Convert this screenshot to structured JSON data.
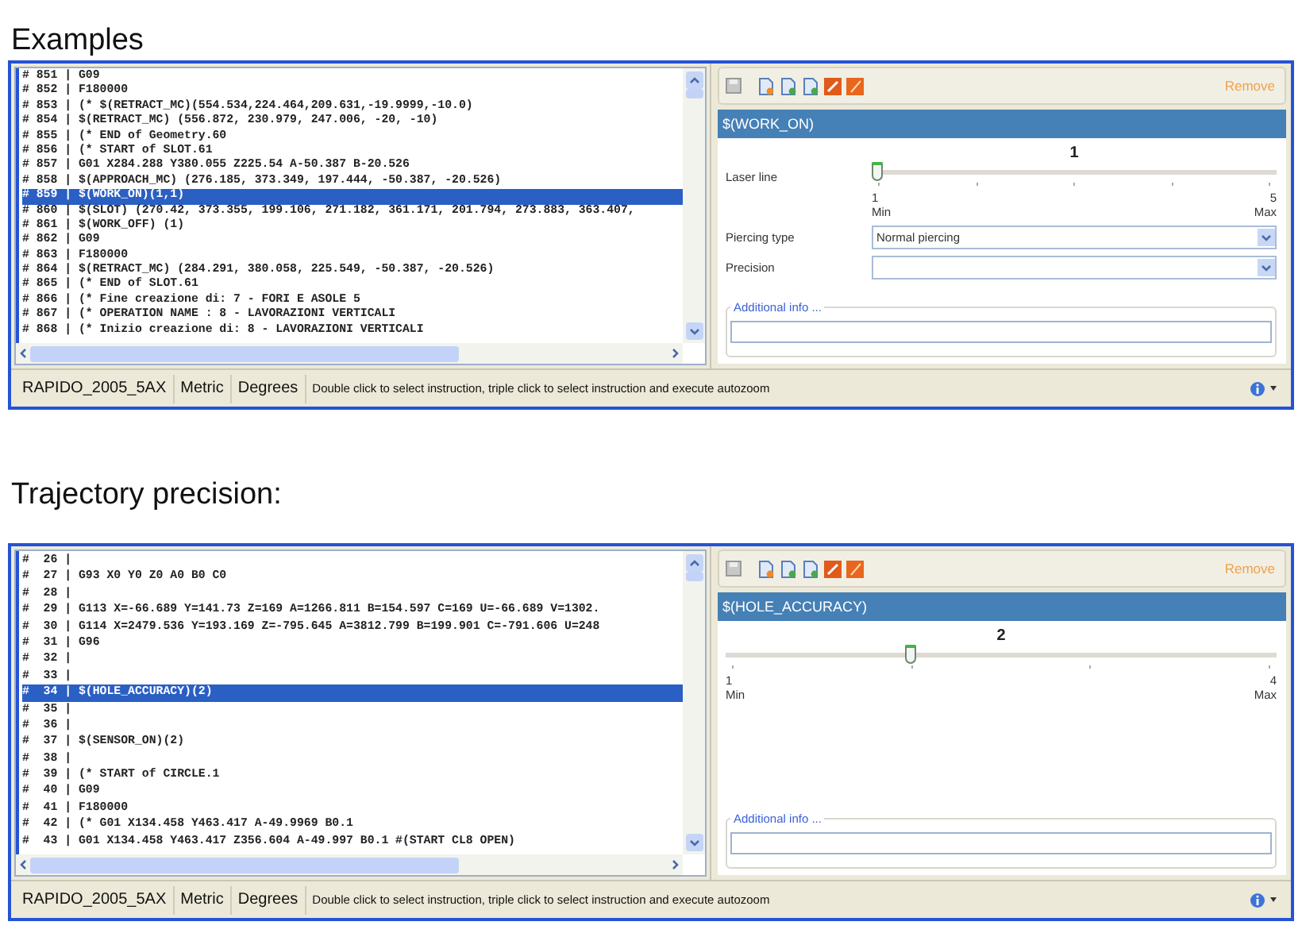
{
  "sections": [
    {
      "heading": "Examples",
      "window": {
        "code_lines": [
          {
            "text": "# 851 | G09",
            "selected": false
          },
          {
            "text": "# 852 | F180000",
            "selected": false
          },
          {
            "text": "# 853 | (* $(RETRACT_MC)(554.534,224.464,209.631,-19.9999,-10.0)",
            "selected": false
          },
          {
            "text": "# 854 | $(RETRACT_MC) (556.872, 230.979, 247.006, -20, -10)",
            "selected": false
          },
          {
            "text": "# 855 | (* END of Geometry.60",
            "selected": false
          },
          {
            "text": "# 856 | (* START of SLOT.61",
            "selected": false
          },
          {
            "text": "# 857 | G01 X284.288 Y380.055 Z225.54 A-50.387 B-20.526",
            "selected": false
          },
          {
            "text": "# 858 | $(APPROACH_MC) (276.185, 373.349, 197.444, -50.387, -20.526)",
            "selected": false
          },
          {
            "text": "# 859 | $(WORK_ON)(1,1)",
            "selected": true
          },
          {
            "text": "# 860 | $(SLOT) (270.42, 373.355, 199.106, 271.182, 361.171, 201.794, 273.883, 363.407,",
            "selected": false
          },
          {
            "text": "# 861 | $(WORK_OFF) (1)",
            "selected": false
          },
          {
            "text": "# 862 | G09",
            "selected": false
          },
          {
            "text": "# 863 | F180000",
            "selected": false
          },
          {
            "text": "# 864 | $(RETRACT_MC) (284.291, 380.058, 225.549, -50.387, -20.526)",
            "selected": false
          },
          {
            "text": "# 865 | (* END of SLOT.61",
            "selected": false
          },
          {
            "text": "# 866 | (* Fine creazione di: 7 - FORI E ASOLE 5",
            "selected": false
          },
          {
            "text": "# 867 | (* OPERATION NAME : 8 - LAVORAZIONI VERTICALI",
            "selected": false
          },
          {
            "text": "# 868 | (* Inizio creazione di: 8 - LAVORAZIONI VERTICALI",
            "selected": false
          }
        ],
        "remove_button": "Remove",
        "instruction": "$(WORK_ON)",
        "slider": {
          "label": "Laser line",
          "value": "1",
          "level": 0,
          "min": "1",
          "min_label": "Min",
          "max": "5",
          "max_label": "Max"
        },
        "fields": [
          {
            "label": "Piercing type",
            "value": "Normal piercing"
          },
          {
            "label": "Precision"
          }
        ],
        "additional_info": "Additional info ...",
        "status_bar": {
          "machine": "RAPIDO_2005_5AX",
          "units": "Metric",
          "angles": "Degrees",
          "hint": "Double click to select instruction, triple click to select instruction and execute autozoom"
        }
      }
    },
    {
      "heading": "Trajectory precision:",
      "window": {
        "code_lines": [
          {
            "text": "#  26 |",
            "selected": false
          },
          {
            "text": "#  27 | G93 X0 Y0 Z0 A0 B0 C0",
            "selected": false
          },
          {
            "text": "#  28 |",
            "selected": false
          },
          {
            "text": "#  29 | G113 X=-66.689 Y=141.73 Z=169 A=1266.811 B=154.597 C=169 U=-66.689 V=1302.",
            "selected": false
          },
          {
            "text": "#  30 | G114 X=2479.536 Y=193.169 Z=-795.645 A=3812.799 B=199.901 C=-791.606 U=248",
            "selected": false
          },
          {
            "text": "#  31 | G96",
            "selected": false
          },
          {
            "text": "#  32 |",
            "selected": false
          },
          {
            "text": "#  33 |",
            "selected": false
          },
          {
            "text": "#  34 | $(HOLE_ACCURACY)(2)",
            "selected": true
          },
          {
            "text": "#  35 |",
            "selected": false
          },
          {
            "text": "#  36 |",
            "selected": false
          },
          {
            "text": "#  37 | $(SENSOR_ON)(2)",
            "selected": false
          },
          {
            "text": "#  38 |",
            "selected": false
          },
          {
            "text": "#  39 | (* START of CIRCLE.1",
            "selected": false
          },
          {
            "text": "#  40 | G09",
            "selected": false
          },
          {
            "text": "#  41 | F180000",
            "selected": false
          },
          {
            "text": "#  42 | (* G01 X134.458 Y463.417 A-49.9969 B0.1",
            "selected": false
          },
          {
            "text": "#  43 | G01 X134.458 Y463.417 Z356.604 A-49.997 B0.1 #(START CL8 OPEN)",
            "selected": false
          }
        ],
        "remove_button": "Remove",
        "instruction": "$(HOLE_ACCURACY)",
        "slider": {
          "value": "2",
          "level": 0.3333,
          "min": "1",
          "min_label": "Min",
          "max": "4",
          "max_label": "Max"
        },
        "additional_info": "Additional info ...",
        "status_bar": {
          "machine": "RAPIDO_2005_5AX",
          "units": "Metric",
          "angles": "Degrees",
          "hint": "Double click to select instruction, triple click to select instruction and execute autozoom"
        }
      }
    }
  ]
}
